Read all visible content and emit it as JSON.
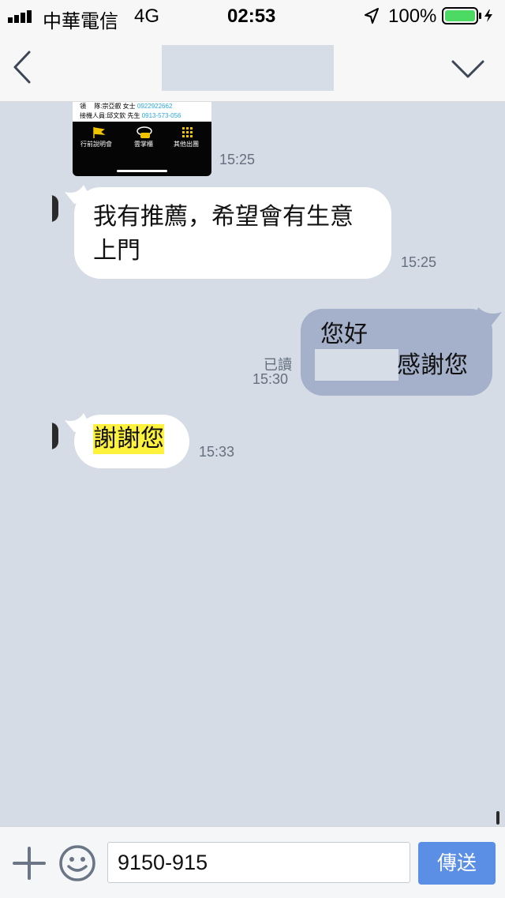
{
  "status_bar": {
    "carrier": "中華電信",
    "network": "4G",
    "time": "02:53",
    "battery": "100%"
  },
  "nav": {
    "back_icon": "chevron-left-icon",
    "menu_icon": "chevron-down-icon"
  },
  "messages": [
    {
      "type": "image",
      "direction": "incoming",
      "time": "15:25",
      "image_text": {
        "line1_label": "領　 隊:宗亞叡 女士",
        "line1_phone": "0922922662",
        "line2_label": "接機人員:邱文欽 先生",
        "line2_phone": "0913-573-056",
        "icons": [
          "行前說明會",
          "雲掌櫃",
          "其他出團"
        ]
      }
    },
    {
      "type": "text",
      "direction": "incoming",
      "line1": "我有推薦，希望會有生意",
      "line2": "上門",
      "time": "15:25"
    },
    {
      "type": "text",
      "direction": "outgoing",
      "line1": "您好",
      "line2": "感謝您",
      "read": "已讀",
      "time": "15:30"
    },
    {
      "type": "text",
      "direction": "incoming",
      "text": "謝謝您",
      "time": "15:33"
    }
  ],
  "input_bar": {
    "value": "9150-915",
    "send_label": "傳送"
  },
  "colors": {
    "chat_background": "#d5dce6",
    "outgoing_bubble": "#a5b1ca",
    "send_button": "#5b8fe6",
    "highlight": "#fff23c"
  }
}
